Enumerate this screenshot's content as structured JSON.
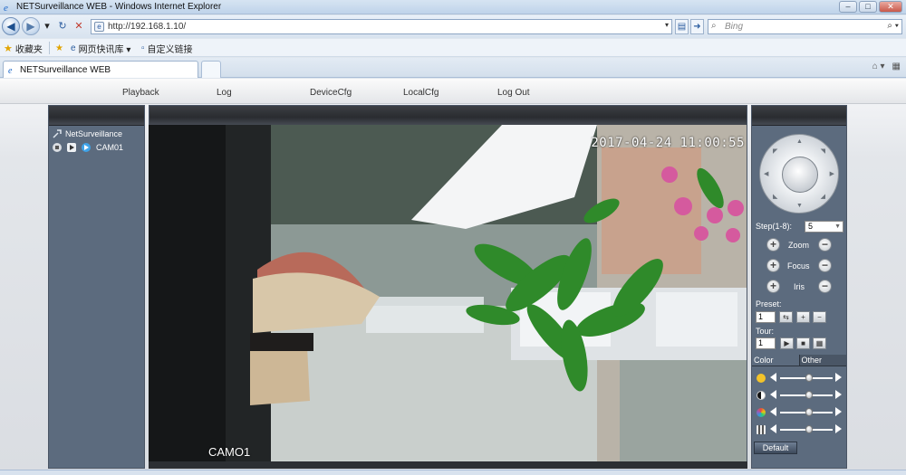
{
  "browser": {
    "window_title": "NETSurveillance WEB - Windows Internet Explorer",
    "url": "http://192.168.1.10/",
    "search_placeholder": "Bing",
    "favorites_label": "收藏夹",
    "fav_items": [
      "网页快讯库 ▾",
      "自定义链接"
    ],
    "tab_label": "NETSurveillance WEB"
  },
  "menu": {
    "items": [
      "Playback",
      "Log",
      "DeviceCfg",
      "LocalCfg",
      "Log Out"
    ]
  },
  "device_tree": {
    "root": "NetSurveillance",
    "camera": "CAM01"
  },
  "video": {
    "timestamp": "2017-04-24 11:00:55",
    "channel_label": "CAMO1"
  },
  "ptz": {
    "step_label": "Step(1-8):",
    "step_value": "5",
    "zoom_label": "Zoom",
    "focus_label": "Focus",
    "iris_label": "Iris",
    "preset_label": "Preset:",
    "preset_value": "1",
    "tour_label": "Tour:",
    "tour_value": "1"
  },
  "color": {
    "tabs": [
      "Color",
      "Other"
    ],
    "sliders": [
      {
        "name": "brightness",
        "value": 0.55
      },
      {
        "name": "contrast",
        "value": 0.55
      },
      {
        "name": "saturation",
        "value": 0.55
      },
      {
        "name": "hue",
        "value": 0.55
      }
    ],
    "default_label": "Default"
  }
}
